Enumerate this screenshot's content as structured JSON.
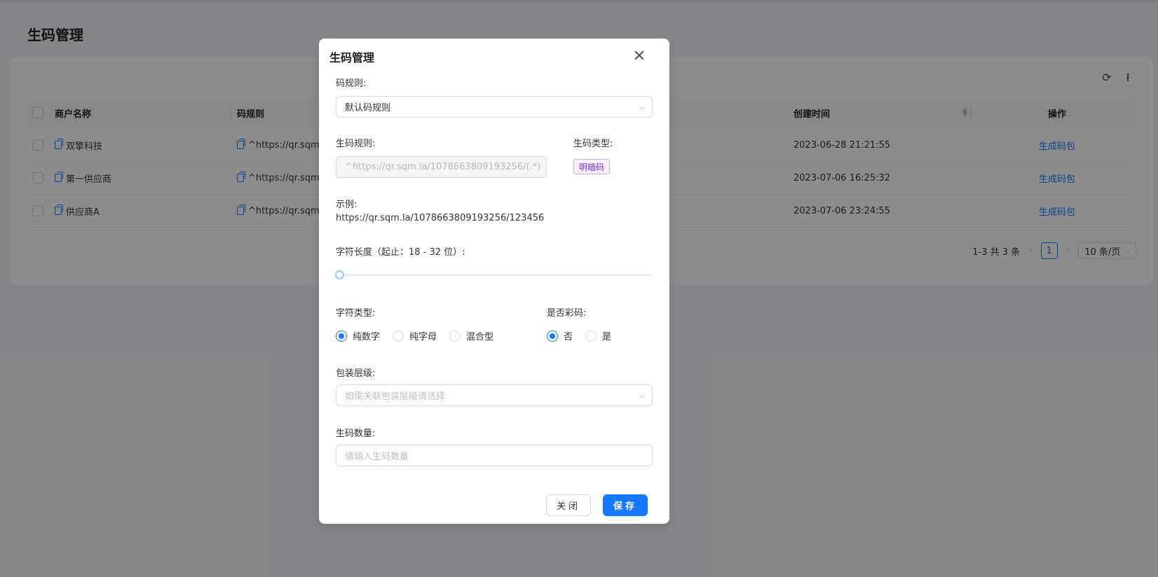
{
  "page": {
    "title": "生码管理",
    "refresh_icon": "refresh-icon",
    "column_height_icon": "column-height-icon"
  },
  "table": {
    "columns": [
      "商户名称",
      "码规则",
      "创建时间",
      "操作"
    ],
    "rows": [
      {
        "merchant": "双擎科技",
        "rule": "^https://qr.sqm",
        "created": "2023-06-28 21:21:55",
        "action": "生成码包"
      },
      {
        "merchant": "第一供应商",
        "rule": "^https://qr.sqm",
        "created": "2023-07-06 16:25:32",
        "action": "生成码包"
      },
      {
        "merchant": "供应商A",
        "rule": "^https://qr.sqm",
        "created": "2023-07-06 23:24:55",
        "action": "生成码包"
      }
    ]
  },
  "pagination": {
    "summary": "1-3 共 3 条",
    "current": "1",
    "page_size": "10 条/页"
  },
  "modal": {
    "title": "生码管理",
    "code_rule_label": "码规则:",
    "code_rule_value": "默认码规则",
    "gen_rule_label": "生码规则:",
    "gen_rule_value": "^https://qr.sqm.la/1078663809193256/(.*)",
    "code_type_label": "生码类型:",
    "code_type_tag": "明暗码",
    "example_label": "示例:",
    "example_value": "https://qr.sqm.la/1078663809193256/123456",
    "length_label": "字符长度（起止：18 - 32 位）:",
    "char_type_label": "字符类型:",
    "char_type_options": [
      "纯数字",
      "纯字母",
      "混合型"
    ],
    "char_type_selected": "纯数字",
    "color_label": "是否彩码:",
    "color_options": [
      "否",
      "是"
    ],
    "color_selected": "否",
    "package_label": "包装层级:",
    "package_placeholder": "如需关联包装层级请选择",
    "quantity_label": "生码数量:",
    "quantity_placeholder": "请输入生码数量",
    "close_button": "关闭",
    "save_button": "保存"
  },
  "colors": {
    "primary": "#1677ff",
    "tag_purple": "#722ed1"
  }
}
